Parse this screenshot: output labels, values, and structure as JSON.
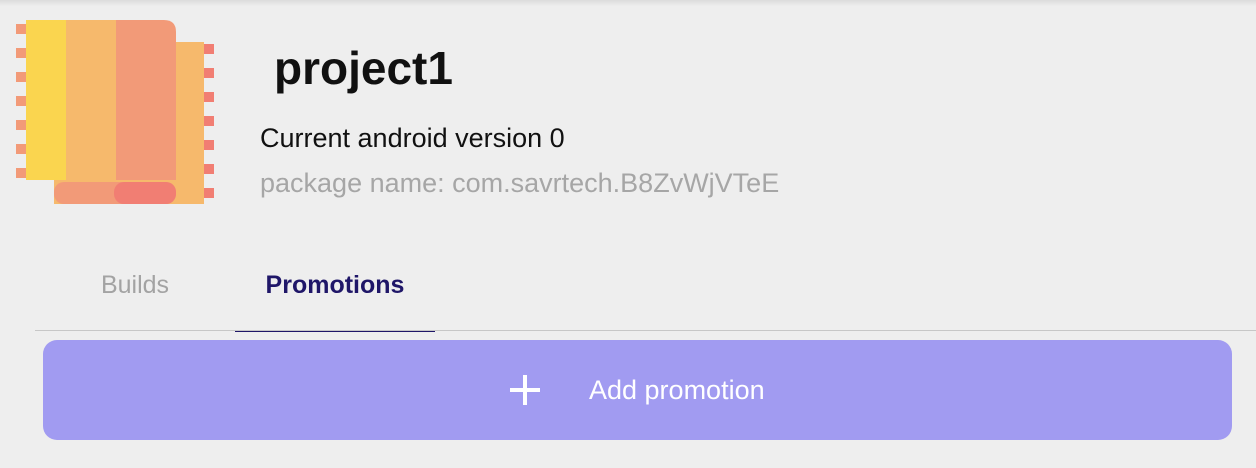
{
  "project": {
    "name": "project1",
    "version_text": "Current android version 0",
    "package_text": "package name: com.savrtech.B8ZvWjVTeE",
    "icon": "app-book-icon"
  },
  "tabs": [
    {
      "label": "Builds",
      "active": false
    },
    {
      "label": "Promotions",
      "active": true
    }
  ],
  "actions": {
    "add_promotion_label": "Add promotion",
    "add_icon": "plus-icon"
  },
  "colors": {
    "background": "#eeeeee",
    "accent": "#1f1668",
    "button": "#a19bf1",
    "muted_text": "#a6a6a6",
    "icon_palette": [
      "#fad54f",
      "#f6b96c",
      "#f29a78",
      "#f17e73"
    ]
  }
}
